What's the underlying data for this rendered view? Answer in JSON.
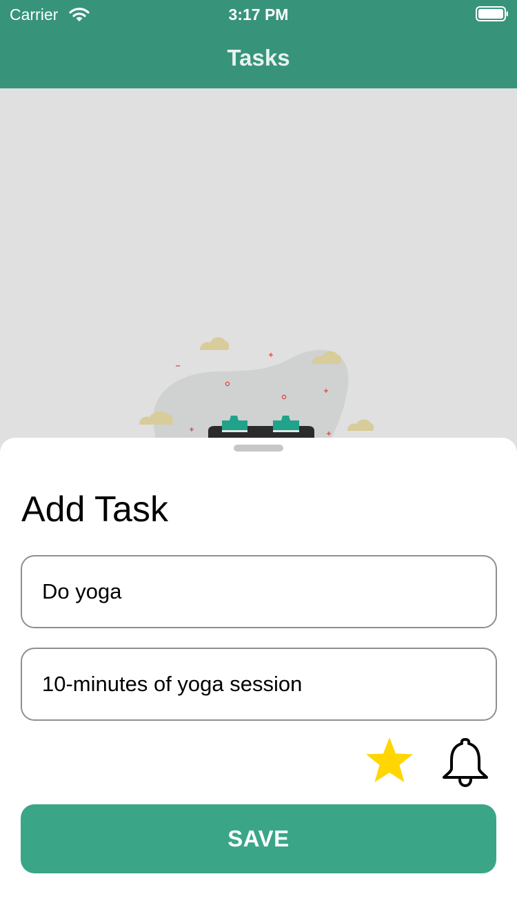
{
  "status_bar": {
    "carrier": "Carrier",
    "time": "3:17 PM"
  },
  "nav": {
    "title": "Tasks"
  },
  "sheet": {
    "title": "Add Task",
    "title_field": {
      "value": "Do yoga",
      "placeholder": ""
    },
    "description_field": {
      "value": "10-minutes of yoga session",
      "placeholder": ""
    },
    "save_label": "SAVE",
    "icons": {
      "favorite": "star-icon",
      "reminder": "bell-icon"
    }
  },
  "colors": {
    "header_green": "#37947a",
    "button_green": "#3aa687",
    "star_yellow": "#ffd600"
  }
}
